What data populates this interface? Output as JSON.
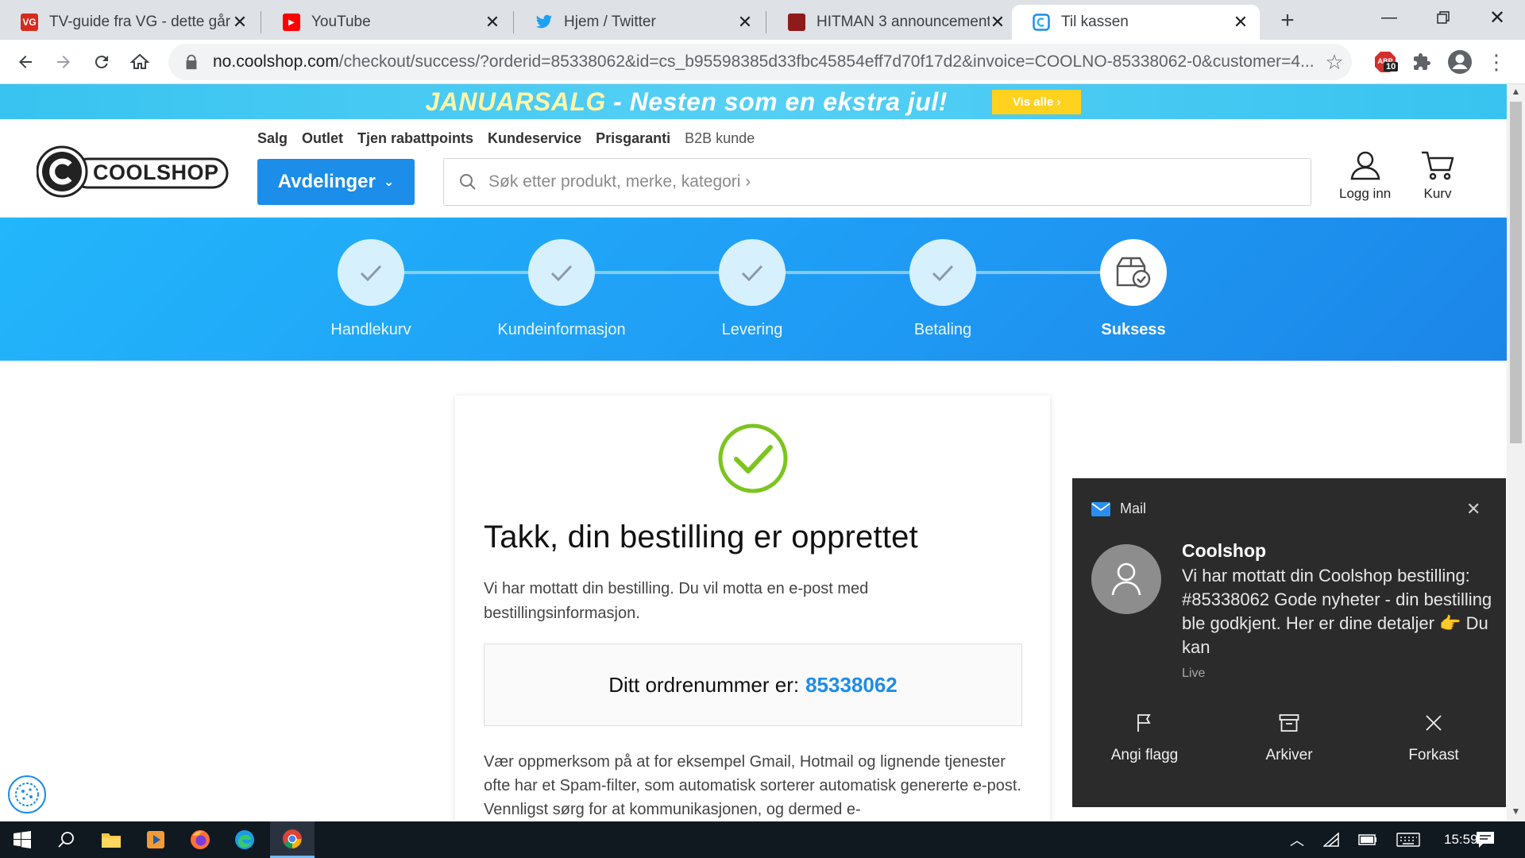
{
  "browser": {
    "tabs": [
      {
        "title": "TV-guide fra VG - dette går",
        "favicon_color": "#d52b1e",
        "favicon_text": "VG"
      },
      {
        "title": "YouTube",
        "favicon_color": "#ff0000",
        "favicon_text": "▶"
      },
      {
        "title": "Hjem / Twitter",
        "favicon_color": "#1da1f2",
        "favicon_text": ""
      },
      {
        "title": "HITMAN 3 announcements",
        "favicon_color": "#b71c1c",
        "favicon_text": ""
      },
      {
        "title": "Til kassen",
        "favicon_color": "#1c8de8",
        "favicon_text": ""
      }
    ],
    "url_host": "no.coolshop.com",
    "url_path": "/checkout/success/?orderid=85338062&id=cs_b95598385d33fbc45854eff7d70f17d2&invoice=COOLNO-85338062-0&customer=4...",
    "abp_badge": "10"
  },
  "promo": {
    "text_highlight": "JANUARSALG",
    "text_rest": " - Nesten som en ekstra jul!",
    "button": "Vis alle ›"
  },
  "header": {
    "logo_text": "COOLSHOP",
    "links": [
      "Salg",
      "Outlet",
      "Tjen rabattpoints",
      "Kundeservice",
      "Prisgaranti"
    ],
    "link_b2b": "B2B kunde",
    "departments": "Avdelinger",
    "search_placeholder": "Søk etter produkt, merke, kategori ›",
    "login": "Logg inn",
    "cart": "Kurv"
  },
  "steps": [
    {
      "label": "Handlekurv",
      "state": "done"
    },
    {
      "label": "Kundeinformasjon",
      "state": "done"
    },
    {
      "label": "Levering",
      "state": "done"
    },
    {
      "label": "Betaling",
      "state": "done"
    },
    {
      "label": "Suksess",
      "state": "current"
    }
  ],
  "success": {
    "title": "Takk, din bestilling er opprettet",
    "lead": "Vi har mottatt din bestilling. Du vil motta en e-post med bestillingsinformasjon.",
    "order_label": "Ditt ordrenummer er:",
    "order_number": "85338062",
    "note": "Vær oppmerksom på at for eksempel Gmail, Hotmail og lignende tjenester ofte har et Spam-filter, som automatisk sorterer automatisk genererte e-post. Vennligst sørg for at kommunikasjonen, og dermed e-"
  },
  "toast": {
    "app": "Mail",
    "sender": "Coolshop",
    "body": "Vi har mottatt din Coolshop bestilling: #85338062 Gode nyheter - din bestilling ble godkjent. Her er dine detaljer 👉 Du kan",
    "tag": "Live",
    "actions": [
      "Angi flagg",
      "Arkiver",
      "Forkast"
    ]
  },
  "taskbar": {
    "clock": "15:59"
  },
  "colors": {
    "brand_blue": "#1c8de8",
    "success_green": "#7cc41f",
    "toast_bg": "#2b2b2b",
    "taskbar_bg": "#101820"
  }
}
